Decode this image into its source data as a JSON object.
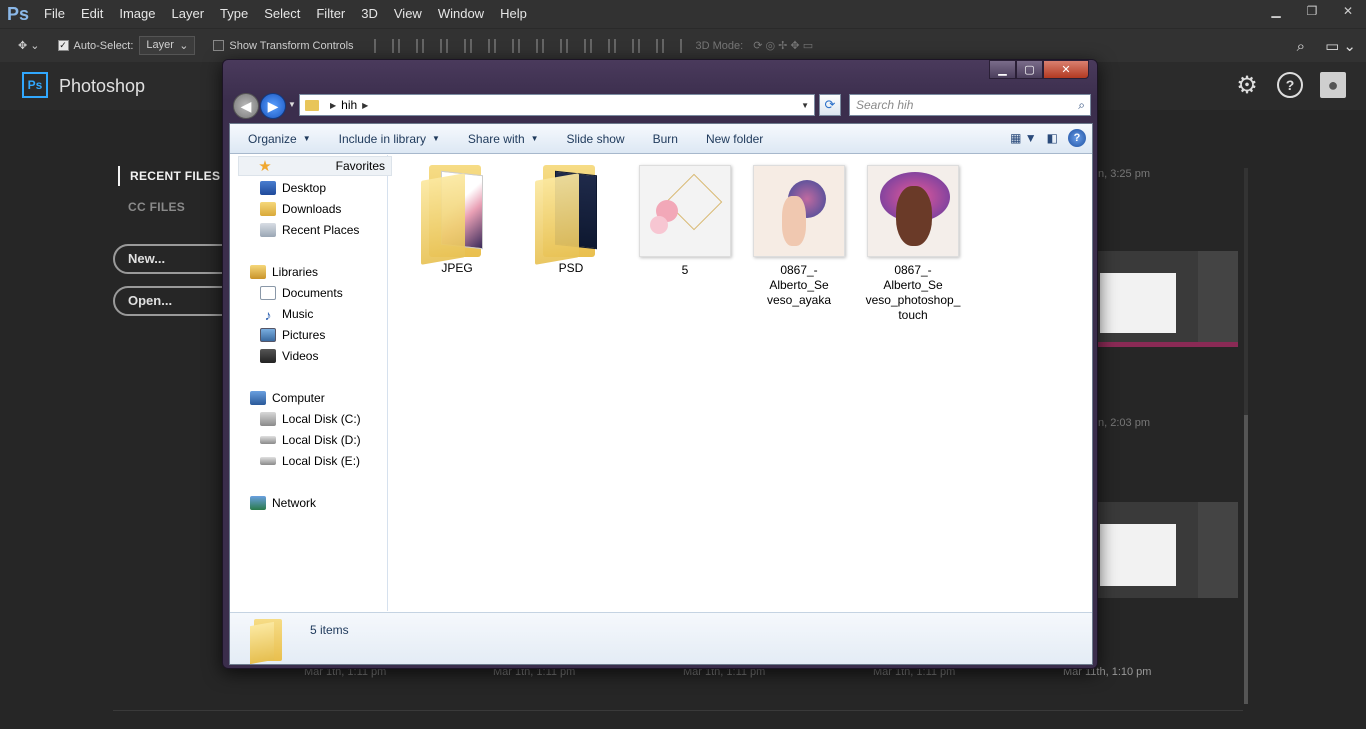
{
  "ps": {
    "logo": "Ps",
    "menu": [
      "File",
      "Edit",
      "Image",
      "Layer",
      "Type",
      "Select",
      "Filter",
      "3D",
      "View",
      "Window",
      "Help"
    ],
    "options": {
      "auto_select_label": "Auto-Select:",
      "auto_select_value": "Layer",
      "transform_label": "Show Transform Controls",
      "mode_3d_label": "3D Mode:"
    },
    "header_title": "Photoshop",
    "nav": {
      "recent": "RECENT FILES",
      "cc": "CC FILES"
    },
    "buttons": {
      "new": "New...",
      "open": "Open..."
    },
    "timestamps": {
      "t1": "n, 3:25 pm",
      "t2": "n, 2:03 pm",
      "b1": "Mar 1th, 1:11 pm",
      "b2": "Mar 1th, 1:11 pm",
      "b3": "Mar 1th, 1:11 pm",
      "b4": "Mar 1th, 1:11 pm",
      "b5": "Mar 11th, 1:10 pm"
    }
  },
  "explorer": {
    "path": "hih",
    "search_placeholder": "Search hih",
    "toolbar": {
      "organize": "Organize",
      "include": "Include in library",
      "share": "Share with",
      "slideshow": "Slide show",
      "burn": "Burn",
      "newfolder": "New folder"
    },
    "tree": {
      "favorites": "Favorites",
      "desktop": "Desktop",
      "downloads": "Downloads",
      "recent": "Recent Places",
      "libraries": "Libraries",
      "documents": "Documents",
      "music": "Music",
      "pictures": "Pictures",
      "videos": "Videos",
      "computer": "Computer",
      "c": "Local Disk (C:)",
      "d": "Local Disk (D:)",
      "e": "Local Disk (E:)",
      "network": "Network"
    },
    "files": {
      "f1": "JPEG",
      "f2": "PSD",
      "f3": "5",
      "f4_l1": "0867_-Alberto_Se",
      "f4_l2": "veso_ayaka",
      "f5_l1": "0867_-Alberto_Se",
      "f5_l2": "veso_photoshop_",
      "f5_l3": "touch"
    },
    "status": "5 items"
  }
}
